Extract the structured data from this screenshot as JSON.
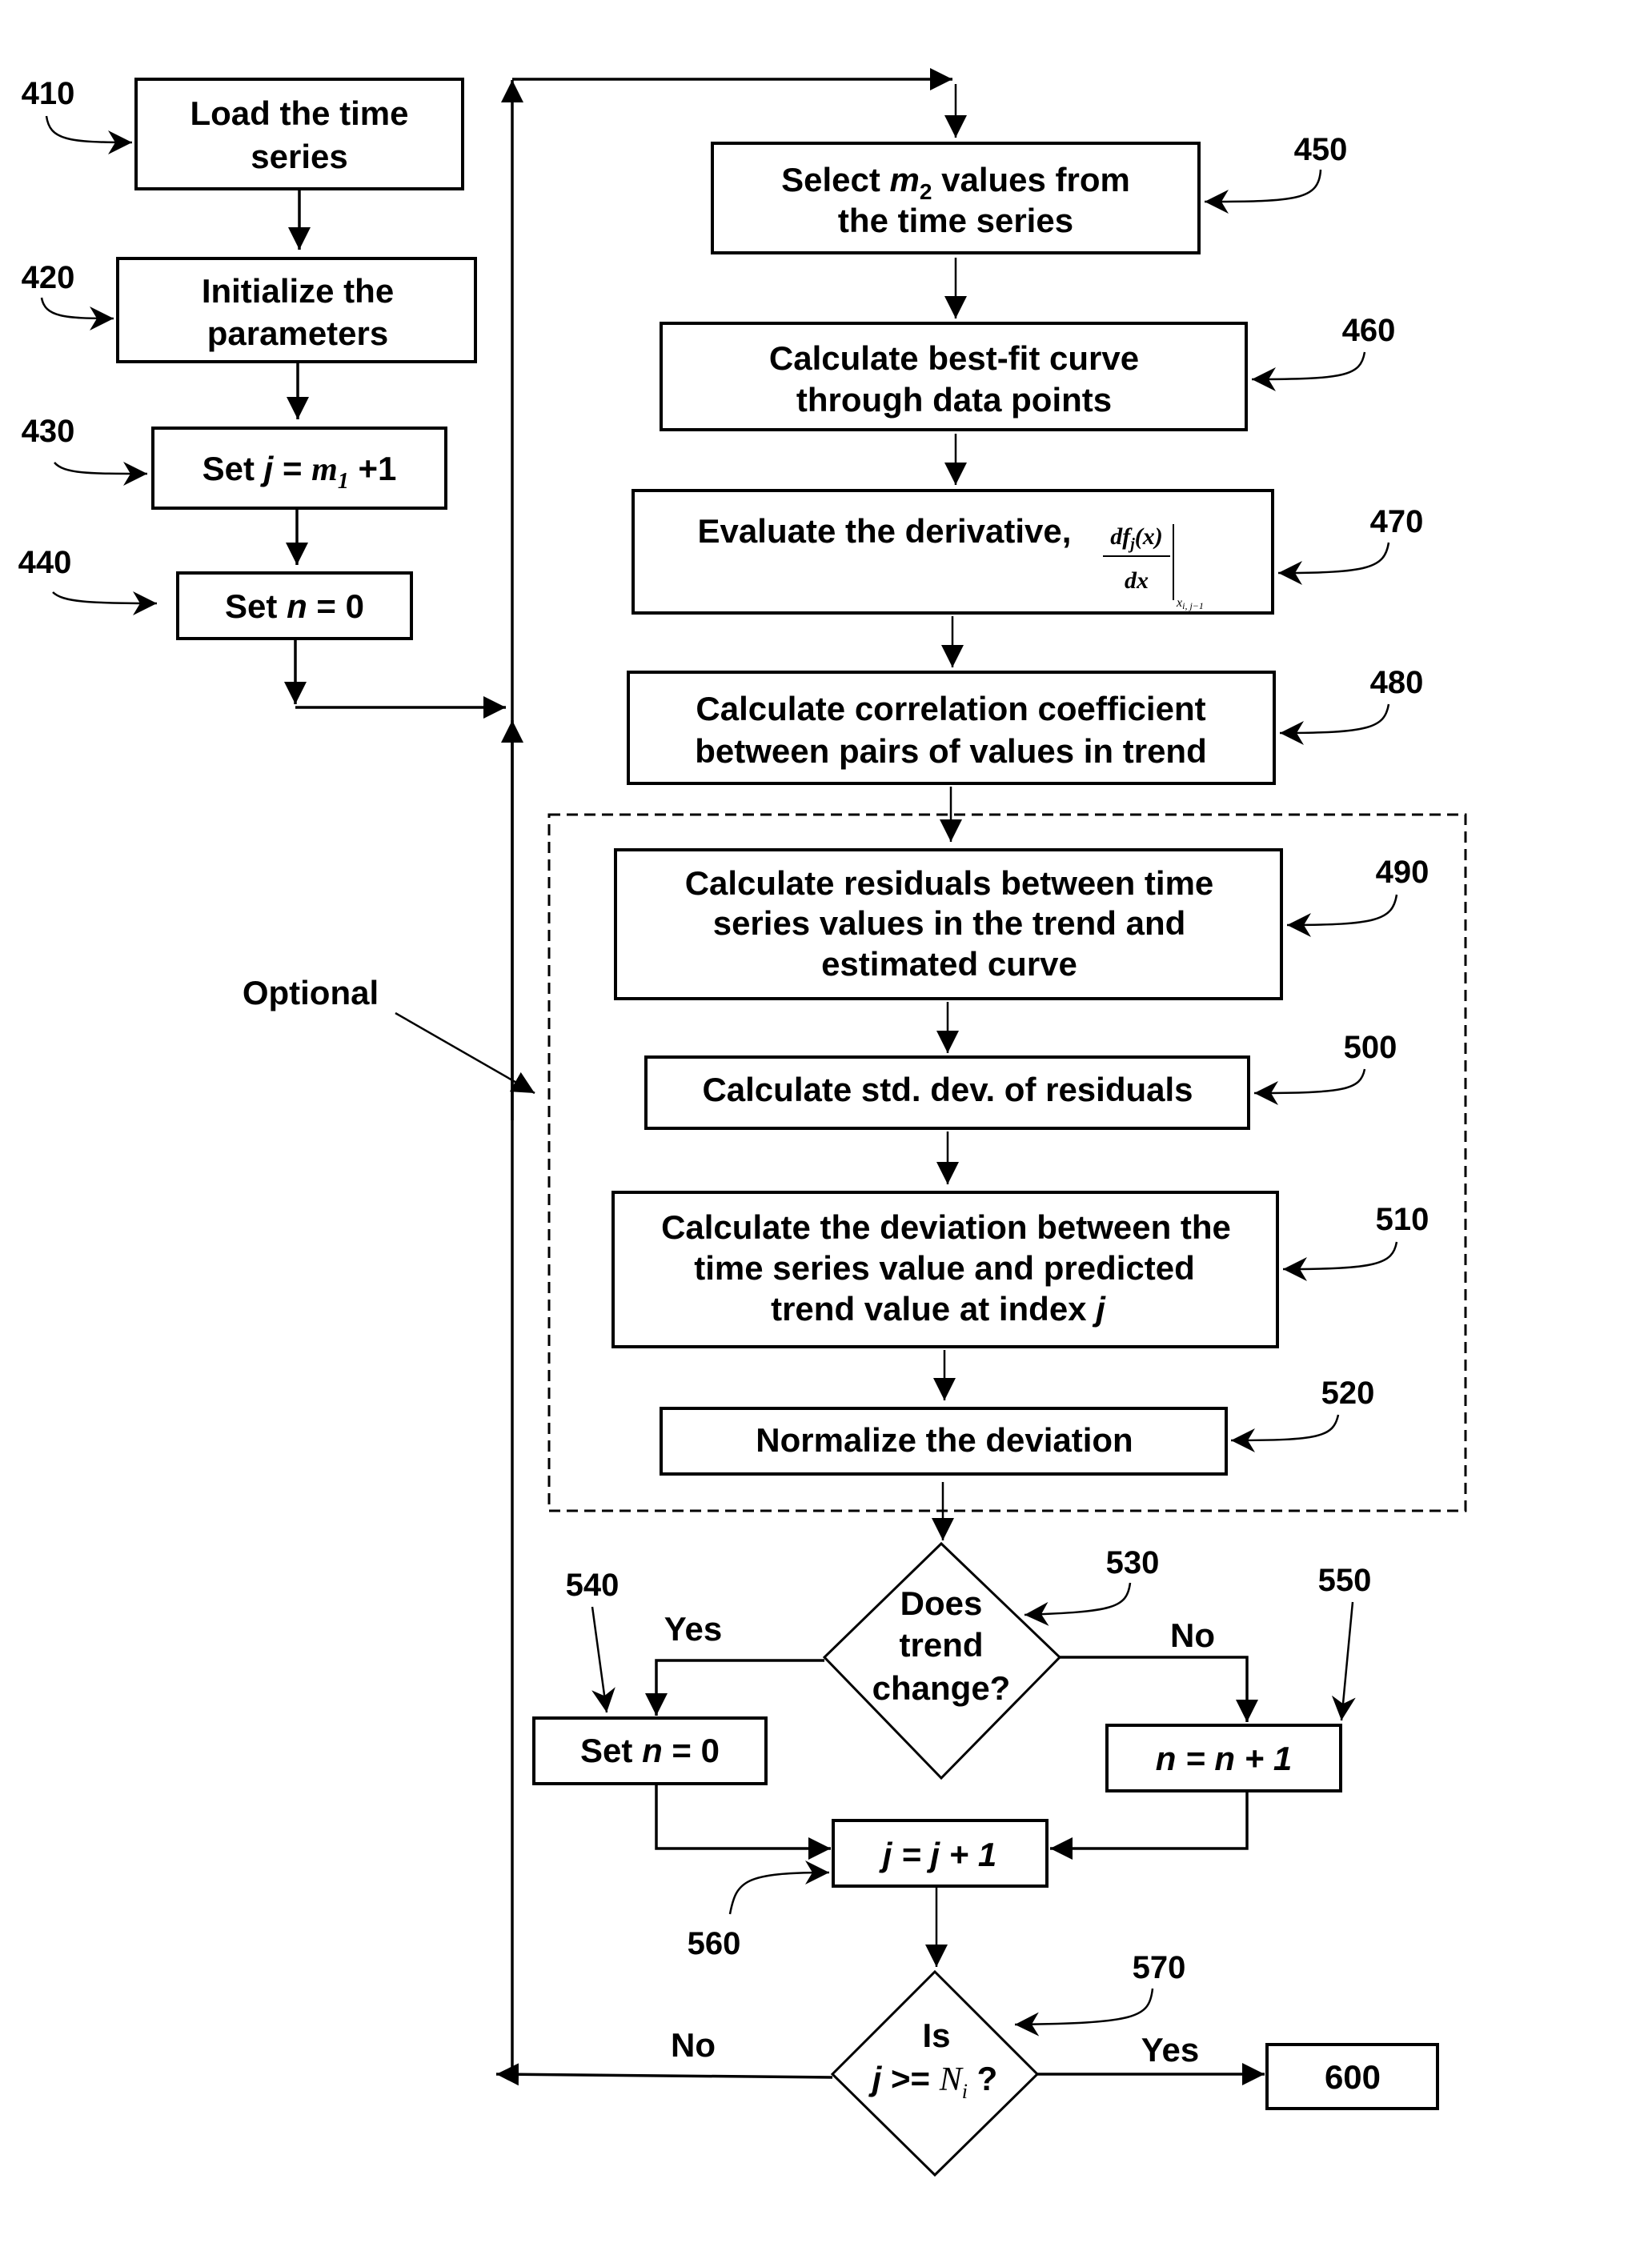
{
  "figure": {
    "type": "flowchart",
    "steps": {
      "s410": {
        "ref": "410",
        "lines": [
          "Load the time",
          "series"
        ]
      },
      "s420": {
        "ref": "420",
        "lines": [
          "Initialize the",
          "parameters"
        ]
      },
      "s430": {
        "ref": "430",
        "prefix": "Set ",
        "var": "j",
        "eq": " = ",
        "var2": "m",
        "sub": "1",
        "suffix": " +1"
      },
      "s440": {
        "ref": "440",
        "prefix": "Set ",
        "var": "n",
        "suffix": " = 0"
      },
      "s450": {
        "ref": "450",
        "line1_prefix": "Select ",
        "line1_var": "m",
        "line1_sub": "2",
        "line1_suffix": " values from",
        "line2": "the time series"
      },
      "s460": {
        "ref": "460",
        "lines": [
          "Calculate best-fit curve",
          "through data points"
        ]
      },
      "s470": {
        "ref": "470",
        "text": "Evaluate the derivative,",
        "numerator": "df",
        "num_sub": "j",
        "num_arg": "(x)",
        "denominator": "dx",
        "eval_at": "x",
        "eval_sub": "i, j−1"
      },
      "s480": {
        "ref": "480",
        "lines": [
          "Calculate correlation coefficient",
          "between pairs of values in trend"
        ]
      },
      "s490": {
        "ref": "490",
        "lines": [
          "Calculate residuals between time",
          "series values in the trend and",
          "estimated curve"
        ]
      },
      "s500": {
        "ref": "500",
        "lines": [
          "Calculate std. dev. of residuals"
        ]
      },
      "s510": {
        "ref": "510",
        "lines": [
          "Calculate the deviation between the",
          "time series value and predicted"
        ],
        "line3_prefix": "trend value at index ",
        "line3_var": "j"
      },
      "s520": {
        "ref": "520",
        "lines": [
          "Normalize the deviation"
        ]
      },
      "s530": {
        "ref": "530",
        "lines": [
          "Does",
          "trend",
          "change?"
        ],
        "yes": "Yes",
        "no": "No"
      },
      "s540": {
        "ref": "540",
        "prefix": "Set ",
        "var": "n",
        "suffix": " = 0"
      },
      "s550": {
        "ref": "550",
        "var": "n",
        "eq": " = ",
        "var2": "n",
        "suffix": " + 1"
      },
      "s560": {
        "ref": "560",
        "var": "j",
        "eq": " = ",
        "var2": "j",
        "suffix": " + 1"
      },
      "s570": {
        "ref": "570",
        "line1": "Is",
        "var": "j",
        "op": " >= ",
        "var2": "N",
        "sub": "i",
        "q": " ?",
        "yes": "Yes",
        "no": "No"
      },
      "s600": {
        "ref": "600",
        "text": "600"
      }
    },
    "optional_label": "Optional"
  }
}
